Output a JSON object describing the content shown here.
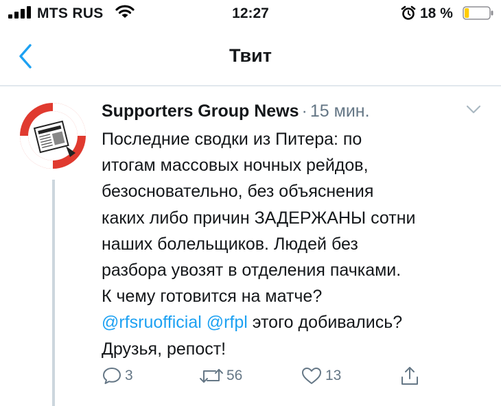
{
  "status_bar": {
    "carrier": "MTS RUS",
    "time": "12:27",
    "battery_percent": "18 %",
    "battery_level": 0.18
  },
  "nav": {
    "title": "Твит"
  },
  "tweet": {
    "author": "Supporters Group News",
    "separator": "·",
    "time": "15 мин.",
    "lines": [
      "Последние сводки из Питера: по",
      "итогам массовых ночных рейдов,",
      "безосновательно, без объяснения",
      "каких либо причин ЗАДЕРЖАНЫ сотни",
      "наших болельщиков. Людей без",
      "разбора увозят в отделения пачками.",
      "К чему готовится на матче?"
    ],
    "mentions": [
      "@rfsruofficial",
      "@rfpl"
    ],
    "line8_tail": " этого добивались?",
    "last_line": "Друзья, репост!",
    "actions": {
      "reply_count": "3",
      "retweet_count": "56",
      "like_count": "13"
    }
  },
  "colors": {
    "accent": "#1da1f2",
    "text": "#14171a",
    "muted": "#657786",
    "divider": "#e1e8ed",
    "avatar_red": "#e03a2f"
  },
  "icons": {
    "signal": "signal-icon",
    "wifi": "wifi-icon",
    "alarm": "alarm-icon",
    "battery": "battery-icon",
    "back": "chevron-left-icon",
    "menu": "chevron-down-icon",
    "reply": "comment-icon",
    "retweet": "retweet-icon",
    "like": "heart-icon",
    "share": "share-icon"
  }
}
